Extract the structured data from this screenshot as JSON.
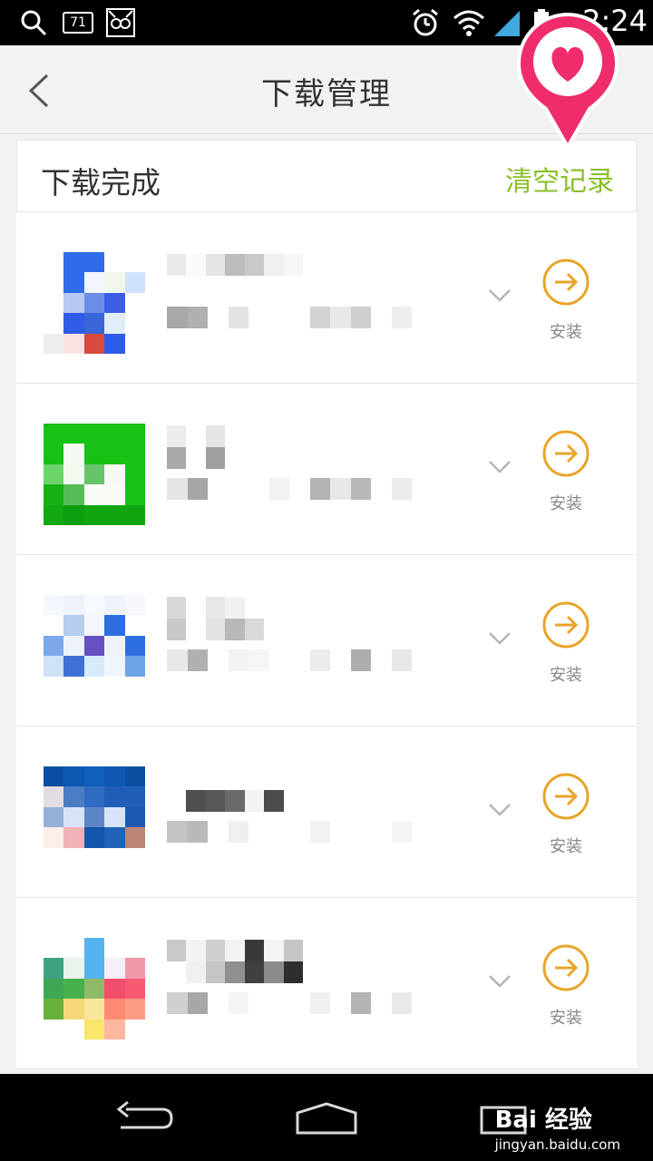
{
  "status_bar": {
    "time": "2:24",
    "notification_badge": "71",
    "icons": [
      "search-icon",
      "notification-count-icon",
      "cat-app-icon",
      "alarm-icon",
      "wifi-icon",
      "signal-icon",
      "battery-icon"
    ]
  },
  "title_bar": {
    "back_icon": "chevron-left-icon",
    "title": "下载管理"
  },
  "section": {
    "title": "下载完成",
    "clear_label": "清空记录"
  },
  "downloads": [
    {
      "install_label": "安装",
      "icon": "app-icon-blue",
      "expand_icon": "chevron-down-icon",
      "action_icon": "arrow-right-circle-icon"
    },
    {
      "install_label": "安装",
      "icon": "app-icon-green",
      "expand_icon": "chevron-down-icon",
      "action_icon": "arrow-right-circle-icon"
    },
    {
      "install_label": "安装",
      "icon": "app-icon-lightblue",
      "expand_icon": "chevron-down-icon",
      "action_icon": "arrow-right-circle-icon"
    },
    {
      "install_label": "安装",
      "icon": "app-icon-darkblue",
      "expand_icon": "chevron-down-icon",
      "action_icon": "arrow-right-circle-icon"
    },
    {
      "install_label": "安装",
      "icon": "app-icon-colorful",
      "expand_icon": "chevron-down-icon",
      "action_icon": "arrow-right-circle-icon"
    }
  ],
  "nav_bar": {
    "icons": [
      "back-nav-icon",
      "home-nav-icon",
      "recents-nav-icon"
    ]
  },
  "watermark": {
    "logo": "Bai 经验",
    "url": "jingyan.baidu.com"
  },
  "colors": {
    "accent_green": "#8bbf2a",
    "install_orange": "#e8a52a",
    "favorite_pink": "#ee2d6a"
  }
}
